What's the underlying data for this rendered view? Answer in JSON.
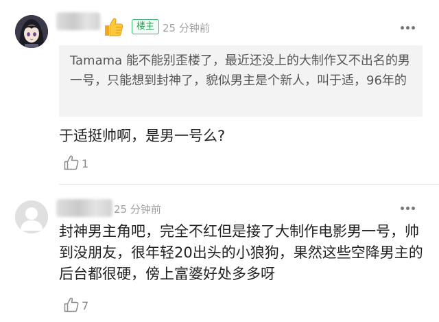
{
  "comments": [
    {
      "badge": "楼主",
      "time": "25 分钟前",
      "quote": "Tamama 能不能别歪楼了，最近还没上的大制作又不出名的男一号，只能想到封神了，貌似男主是个新人，叫于适，96年的",
      "text": "于适挺帅啊，是男一号么?",
      "likes": "1"
    },
    {
      "time": "25 分钟前",
      "text": "封神男主角吧，完全不红但是接了大制作电影男一号，帅到没朋友，很年轻20出头的小狼狗，果然这些空降男主的后台都很硬，傍上富婆好处多多呀",
      "likes": "7"
    }
  ],
  "icons": {
    "more": "more-dots-icon",
    "like": "thumbs-up-icon",
    "emoji": "thumbs-up-emoji-icon"
  },
  "colors": {
    "badge_green": "#2ea05a",
    "meta_gray": "#a0a0a0",
    "quote_bg": "#f3f3f3"
  }
}
